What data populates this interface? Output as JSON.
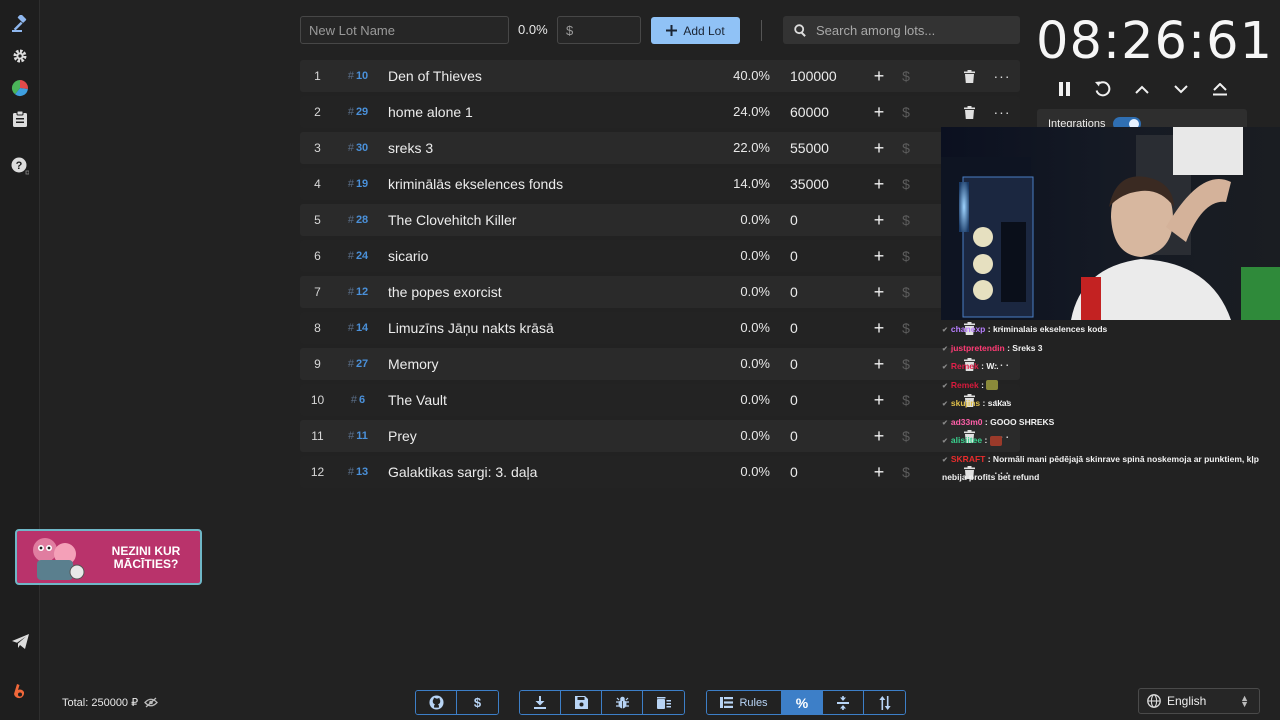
{
  "colors": {
    "accent": "#90c2f6",
    "lot_id": "#4a90d9",
    "background": "#222222"
  },
  "sidebar": {
    "items": [
      {
        "icon": "gavel-icon"
      },
      {
        "icon": "gear-icon"
      },
      {
        "icon": "pie-chart-icon"
      },
      {
        "icon": "clipboard-icon"
      },
      {
        "icon": "help-icon"
      },
      {
        "icon": "telegram-icon"
      },
      {
        "icon": "boosty-icon"
      }
    ]
  },
  "toolbar": {
    "lot_name_placeholder": "New Lot Name",
    "percent": "0.0%",
    "amount_placeholder": "$",
    "add_lot_label": "Add Lot",
    "search_placeholder": "Search among lots..."
  },
  "lots": [
    {
      "index": "1",
      "id": "10",
      "name": "Den of Thieves",
      "percent": "40.0%",
      "amount": "100000"
    },
    {
      "index": "2",
      "id": "29",
      "name": "home alone 1",
      "percent": "24.0%",
      "amount": "60000"
    },
    {
      "index": "3",
      "id": "30",
      "name": "sreks 3",
      "percent": "22.0%",
      "amount": "55000"
    },
    {
      "index": "4",
      "id": "19",
      "name": "kriminālās ekselences fonds",
      "percent": "14.0%",
      "amount": "35000"
    },
    {
      "index": "5",
      "id": "28",
      "name": "The Clovehitch Killer",
      "percent": "0.0%",
      "amount": "0"
    },
    {
      "index": "6",
      "id": "24",
      "name": "sicario",
      "percent": "0.0%",
      "amount": "0"
    },
    {
      "index": "7",
      "id": "12",
      "name": "the popes exorcist",
      "percent": "0.0%",
      "amount": "0"
    },
    {
      "index": "8",
      "id": "14",
      "name": "Limuzīns Jāņu nakts krāsā",
      "percent": "0.0%",
      "amount": "0"
    },
    {
      "index": "9",
      "id": "27",
      "name": "Memory",
      "percent": "0.0%",
      "amount": "0"
    },
    {
      "index": "10",
      "id": "6",
      "name": "The Vault",
      "percent": "0.0%",
      "amount": "0"
    },
    {
      "index": "11",
      "id": "11",
      "name": "Prey",
      "percent": "0.0%",
      "amount": "0"
    },
    {
      "index": "12",
      "id": "13",
      "name": "Galaktikas sargi: 3. daļa",
      "percent": "0.0%",
      "amount": "0"
    }
  ],
  "lot_actions": {
    "plus": "+",
    "dollar": "$",
    "more": "···",
    "hash": "#"
  },
  "timer": {
    "display": "08:26:61",
    "controls": [
      "pause-icon",
      "reset-icon",
      "chevron-up-icon",
      "chevron-down-icon",
      "eject-icon"
    ]
  },
  "integrations": {
    "label": "Integrations",
    "enabled": true
  },
  "chat": [
    {
      "user": "chanexp",
      "text": ": kriminalais ekselences kods",
      "cls": "u1"
    },
    {
      "user": "justpretendin",
      "text": ": Sreks 3",
      "cls": "u2"
    },
    {
      "user": "Remek",
      "text": ": W..",
      "cls": "u3"
    },
    {
      "user": "Remek",
      "text": ":",
      "cls": "u4",
      "emote": true
    },
    {
      "user": "skujins",
      "text": ": sakas",
      "cls": "u5"
    },
    {
      "user": "ad33m0",
      "text": ": GOOO SHREKS",
      "cls": "u6"
    },
    {
      "user": "alisiitee",
      "text": ":",
      "cls": "u7",
      "emote": true
    },
    {
      "user": "SKRAFT",
      "text": ": Normāli mani pēdējajā skinrave spinā noskemoja ar punktiem, kļp nebija profits bet refund",
      "cls": "u8"
    }
  ],
  "promo": {
    "text": "NEZINI KUR MĀCĪTIES?"
  },
  "footer": {
    "total": "Total: 250000 ₽",
    "group1": [
      {
        "icon": "github-icon"
      },
      {
        "icon": "dollar-icon"
      }
    ],
    "group2": [
      {
        "icon": "download-icon"
      },
      {
        "icon": "save-icon"
      },
      {
        "icon": "bug-icon"
      },
      {
        "icon": "delete-list-icon"
      }
    ],
    "rules_label": "Rules",
    "language": "English"
  }
}
